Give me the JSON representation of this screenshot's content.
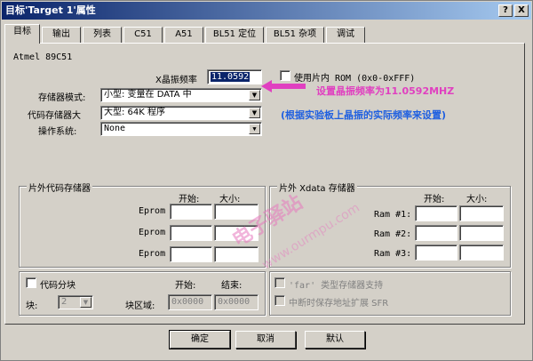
{
  "window": {
    "title": "目标'Target 1'属性",
    "help": "?",
    "close": "X"
  },
  "tabs": [
    "目标",
    "输出",
    "列表",
    "C51",
    "A51",
    "BL51 定位",
    "BL51 杂项",
    "调试"
  ],
  "device": "Atmel 89C51",
  "xtal": {
    "label": "X晶振频率",
    "value": "11.0592"
  },
  "onchip_rom": {
    "label": "使用片内 ROM (0x0-0xFFF)"
  },
  "memory_model": {
    "label": "存储器模式:",
    "value": "小型: 变量在 DATA 中"
  },
  "code_rom": {
    "label": "代码存储器大",
    "value": "大型: 64K 程序"
  },
  "os": {
    "label": "操作系统:",
    "value": "None"
  },
  "annotations": {
    "line1": "设置晶振频率为11.0592MHZ",
    "line2": "(根据实验板上晶振的实际频率来设置)"
  },
  "offchip_code": {
    "title": "片外代码存储器",
    "start_label": "开始:",
    "size_label": "大小:",
    "rows": [
      "Eprom",
      "Eprom",
      "Eprom"
    ]
  },
  "offchip_xdata": {
    "title": "片外 Xdata 存储器",
    "start_label": "开始:",
    "size_label": "大小:",
    "rows": [
      "Ram #1:",
      "Ram #2:",
      "Ram #3:"
    ]
  },
  "code_banking": {
    "label": "代码分块",
    "start_label": "开始:",
    "end_label": "结束:",
    "bank_label": "块:",
    "bank_value": "2",
    "area_label": "块区域:",
    "area_start": "0x0000",
    "area_end": "0x0000"
  },
  "far_support": {
    "label": "'far' 类型存储器支持"
  },
  "sfr_save": {
    "label": "中断时保存地址扩展 SFR"
  },
  "buttons": {
    "ok": "确定",
    "cancel": "取消",
    "default": "默认"
  },
  "watermark": {
    "line1": "电子驿站",
    "line2": "www.ourmpu.com"
  },
  "colors": {
    "annotation_pink": "#e040c0",
    "annotation_blue": "#2060e0",
    "title_bar": "#0a246a"
  }
}
